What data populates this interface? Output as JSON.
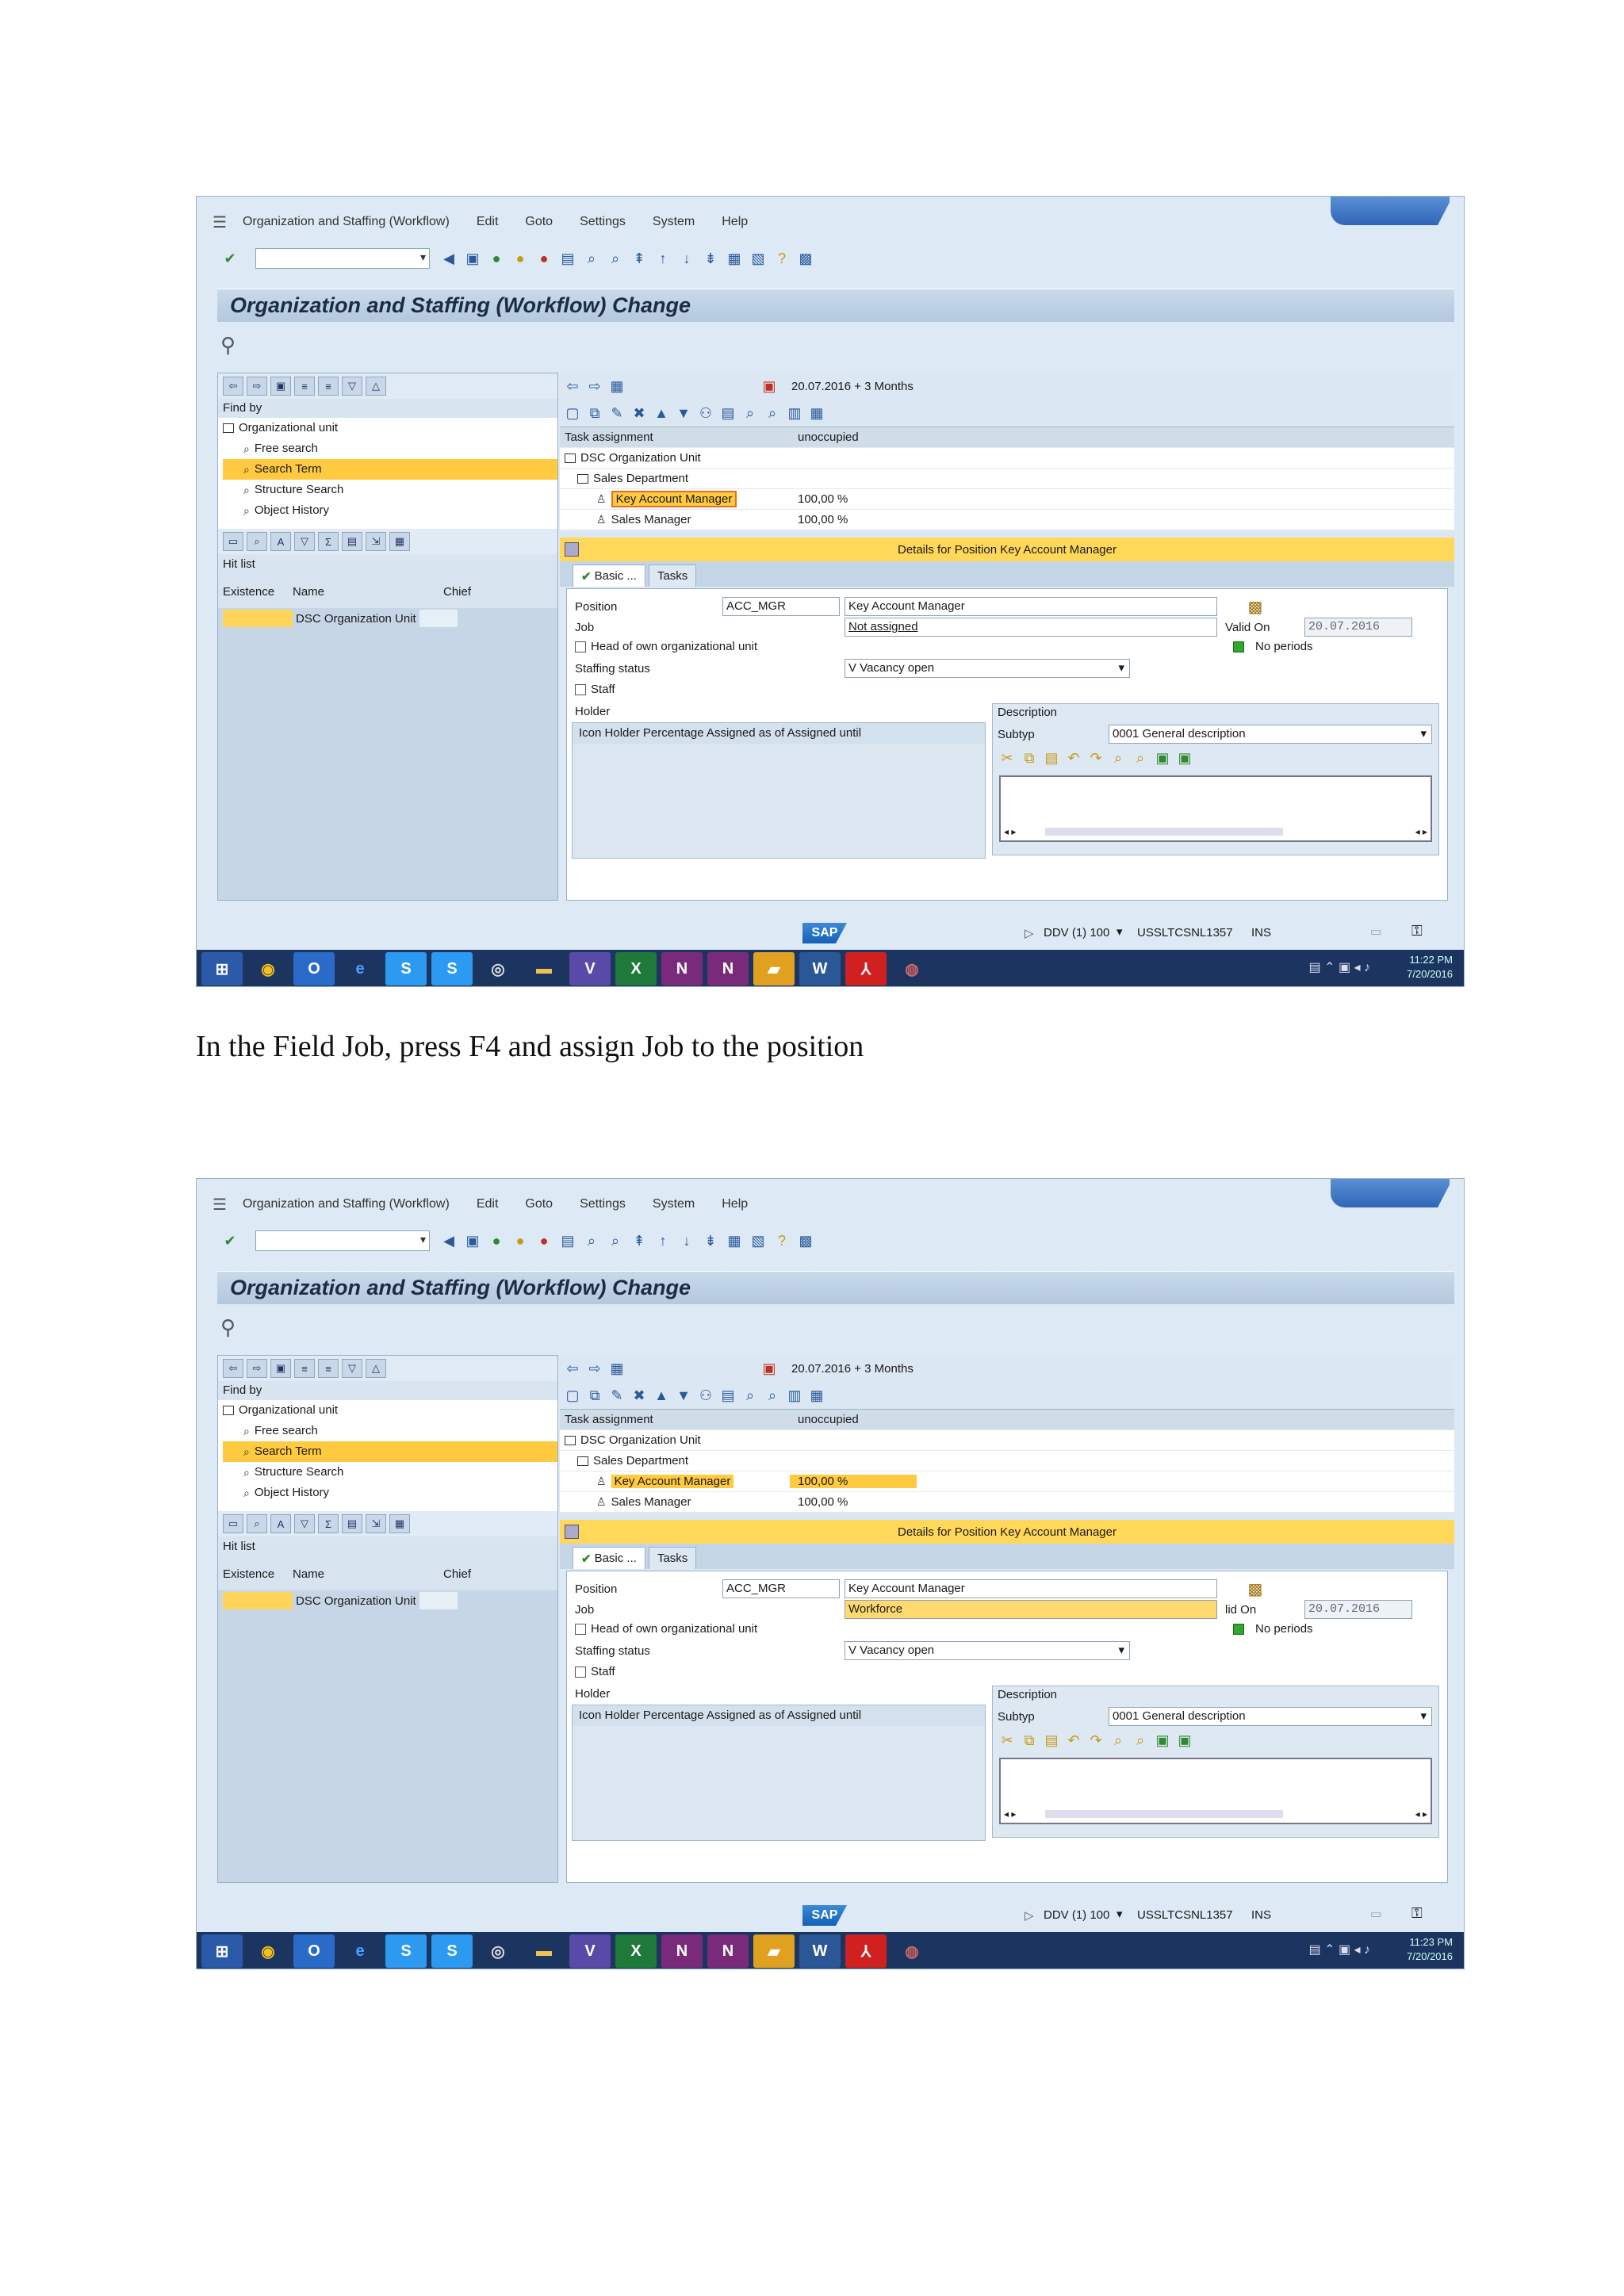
{
  "screenshots": [
    {
      "menu": [
        "Organization and Staffing (Workflow)",
        "Edit",
        "Goto",
        "Settings",
        "System",
        "Help"
      ],
      "title": "Organization and Staffing (Workflow) Change",
      "date_range": "20.07.2016  + 3 Months",
      "find_by": "Find by",
      "search_tree": [
        {
          "label": "Organizational unit",
          "type": "folder",
          "highlight": false
        },
        {
          "label": "Free search",
          "type": "binoculars",
          "highlight": false
        },
        {
          "label": "Search Term",
          "type": "binoculars",
          "highlight": true
        },
        {
          "label": "Structure Search",
          "type": "binoculars",
          "highlight": false
        },
        {
          "label": "Object History",
          "type": "binoculars",
          "highlight": false
        }
      ],
      "hit_list": "Hit list",
      "hit_headers": [
        "Existence",
        "Name",
        "Chief"
      ],
      "hit_row": "DSC Organization Unit",
      "task_header": [
        "Task assignment",
        "unoccupied"
      ],
      "task_rows": [
        {
          "label": "DSC Organization Unit",
          "value": "",
          "type": "folder",
          "hl": false
        },
        {
          "label": "Sales Department",
          "value": "",
          "type": "folder",
          "hl": false
        },
        {
          "label": "Key Account Manager",
          "value": "100,00 %",
          "type": "person",
          "hl": true
        },
        {
          "label": "Sales Manager",
          "value": "100,00 %",
          "type": "person",
          "hl": false
        }
      ],
      "details_title": "Details for Position Key Account Manager",
      "tabs": [
        "Basic ...",
        "Tasks"
      ],
      "position_label": "Position",
      "position_code": "ACC_MGR",
      "position_name": "Key Account Manager",
      "job_label": "Job",
      "job_value": "Not assigned",
      "valid_on_label": "Valid On",
      "valid_on_value": "20.07.2016",
      "no_periods": "No periods",
      "head_label": "Head of own organizational unit",
      "staffing_label": "Staffing status",
      "staffing_value": "V Vacancy open",
      "staff_label": "Staff",
      "holder_label": "Holder",
      "holder_cols": "Icon  Holder  Percentage  Assigned as of  Assigned until",
      "desc_label": "Description",
      "subtyp_label": "Subtyp",
      "subtyp_value": "0001 General description",
      "system": "DDV (1) 100",
      "server": "USSLTCSNL1357",
      "mode": "INS",
      "time": "11:22 PM",
      "date": "7/20/2016"
    },
    {
      "menu": [
        "Organization and Staffing (Workflow)",
        "Edit",
        "Goto",
        "Settings",
        "System",
        "Help"
      ],
      "title": "Organization and Staffing (Workflow) Change",
      "date_range": "20.07.2016  + 3 Months",
      "find_by": "Find by",
      "search_tree": [
        {
          "label": "Organizational unit",
          "type": "folder",
          "highlight": false
        },
        {
          "label": "Free search",
          "type": "binoculars",
          "highlight": false
        },
        {
          "label": "Search Term",
          "type": "binoculars",
          "highlight": true
        },
        {
          "label": "Structure Search",
          "type": "binoculars",
          "highlight": false
        },
        {
          "label": "Object History",
          "type": "binoculars",
          "highlight": false
        }
      ],
      "hit_list": "Hit list",
      "hit_headers": [
        "Existence",
        "Name",
        "Chief"
      ],
      "hit_row": "DSC Organization Unit",
      "task_header": [
        "Task assignment",
        "unoccupied"
      ],
      "task_rows": [
        {
          "label": "DSC Organization Unit",
          "value": "",
          "type": "folder",
          "hl": false
        },
        {
          "label": "Sales Department",
          "value": "",
          "type": "folder",
          "hl": false
        },
        {
          "label": "Key Account Manager",
          "value": "100,00 %",
          "type": "person",
          "hl": true
        },
        {
          "label": "Sales Manager",
          "value": "100,00 %",
          "type": "person",
          "hl": false
        }
      ],
      "details_title": "Details for Position Key Account Manager",
      "tabs": [
        "Basic ...",
        "Tasks"
      ],
      "position_label": "Position",
      "position_code": "ACC_MGR",
      "position_name": "Key Account Manager",
      "job_label": "Job",
      "job_value": "Workforce",
      "valid_on_label": "lid On",
      "valid_on_value": "20.07.2016",
      "no_periods": "No periods",
      "head_label": "Head of own organizational unit",
      "staffing_label": "Staffing status",
      "staffing_value": "V Vacancy open",
      "staff_label": "Staff",
      "holder_label": "Holder",
      "holder_cols": "Icon  Holder  Percentage  Assigned as of  Assigned until",
      "desc_label": "Description",
      "subtyp_label": "Subtyp",
      "subtyp_value": "0001 General description",
      "system": "DDV (1) 100",
      "server": "USSLTCSNL1357",
      "mode": "INS",
      "time": "11:23 PM",
      "date": "7/20/2016"
    }
  ],
  "caption": "In the Field  Job, press F4 and assign  Job to the position"
}
